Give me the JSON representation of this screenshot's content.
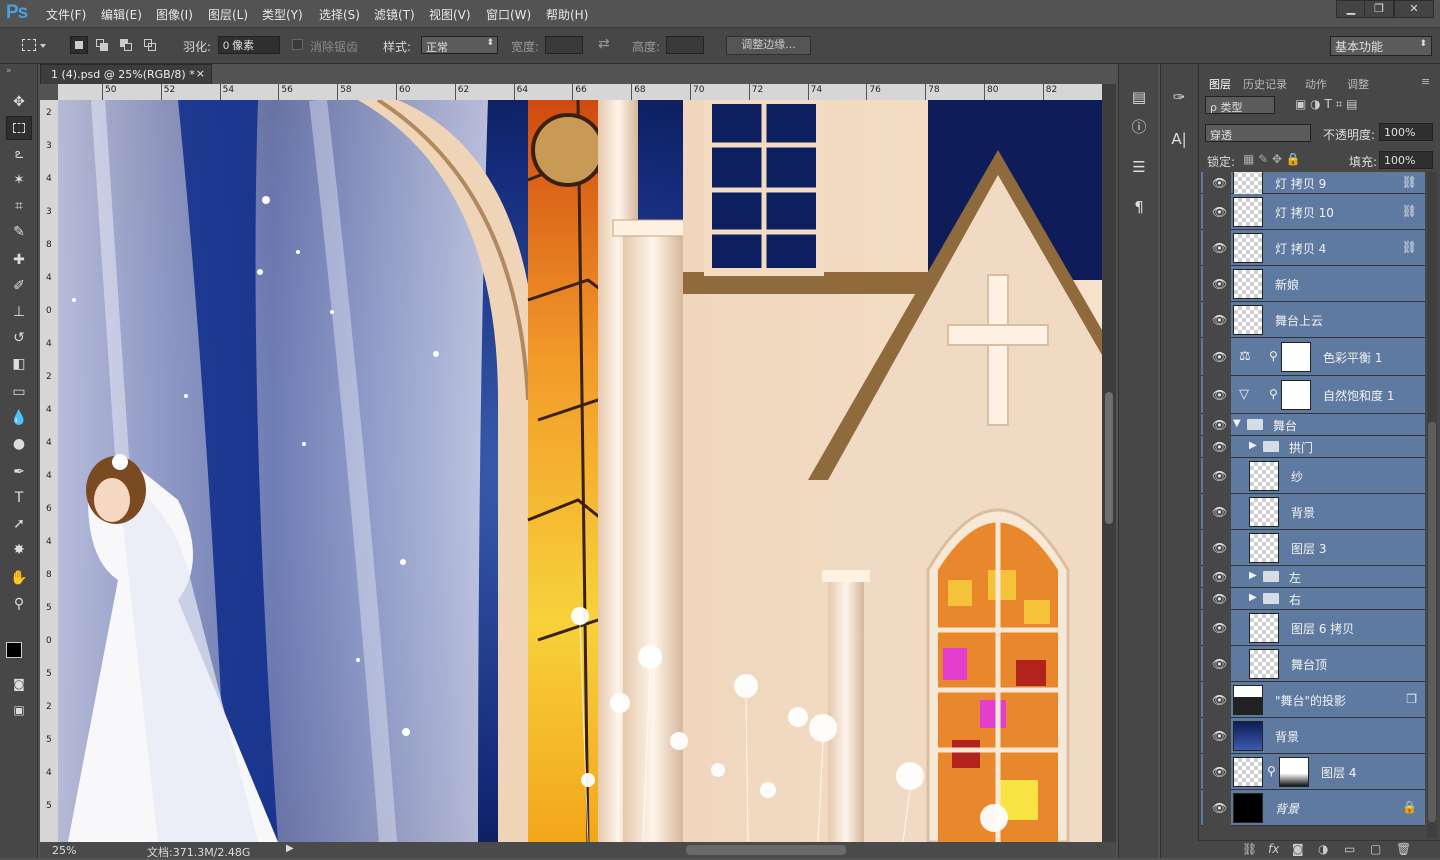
{
  "app": {
    "logo": "Ps"
  },
  "menu": [
    "文件(F)",
    "编辑(E)",
    "图像(I)",
    "图层(L)",
    "类型(Y)",
    "选择(S)",
    "滤镜(T)",
    "视图(V)",
    "窗口(W)",
    "帮助(H)"
  ],
  "window_controls": [
    "▁",
    "❐",
    "✕"
  ],
  "options": {
    "feather_label": "羽化:",
    "feather_value": "0 像素",
    "antialias_label": "消除锯齿",
    "style_label": "样式:",
    "style_value": "正常",
    "width_label": "宽度:",
    "height_label": "高度:",
    "refine_button": "调整边缘...",
    "workspace": "基本功能"
  },
  "document": {
    "tab_title": "1 (4).psd @ 25%(RGB/8) *",
    "close": "×",
    "zoom": "25%",
    "doc_info": "文档:371.3M/2.48G"
  },
  "ruler_h": [
    "50",
    "52",
    "54",
    "56",
    "58",
    "60",
    "62",
    "64",
    "66",
    "68",
    "70",
    "72",
    "74",
    "76",
    "78",
    "80",
    "82"
  ],
  "ruler_v": [
    "2",
    "3",
    "4",
    "3",
    "8",
    "4",
    "0",
    "4",
    "2",
    "4",
    "4",
    "4",
    "6",
    "4",
    "8",
    "5",
    "0",
    "5",
    "2",
    "5",
    "4",
    "5"
  ],
  "panel": {
    "tabs": [
      "图层",
      "历史记录",
      "动作",
      "调整"
    ],
    "filter_kind": "ρ 类型",
    "blend_mode": "穿透",
    "opacity_label": "不透明度:",
    "opacity_value": "100%",
    "lock_label": "锁定:",
    "fill_label": "填充:",
    "fill_value": "100%"
  },
  "layers": [
    {
      "name": "灯 拷贝 9",
      "thumb": "check",
      "link": true
    },
    {
      "name": "灯 拷贝 10",
      "thumb": "check",
      "link": true
    },
    {
      "name": "灯 拷贝 4",
      "thumb": "check",
      "link": true
    },
    {
      "name": "新娘",
      "thumb": "check"
    },
    {
      "name": "舞台上云",
      "thumb": "check"
    },
    {
      "name": "色彩平衡 1",
      "thumb": "white",
      "adj": "⚖"
    },
    {
      "name": "自然饱和度 1",
      "thumb": "white",
      "adj": "▽"
    },
    {
      "name": "舞台",
      "group": true,
      "open": true
    },
    {
      "name": "拱门",
      "group": true,
      "indent": true
    },
    {
      "name": "纱",
      "thumb": "check",
      "indent": true
    },
    {
      "name": "背景",
      "thumb": "check",
      "indent": true
    },
    {
      "name": "图层 3",
      "thumb": "check",
      "indent": true
    },
    {
      "name": "左",
      "group": true,
      "indent": true
    },
    {
      "name": "右",
      "group": true,
      "indent": true
    },
    {
      "name": "图层 6 拷贝",
      "thumb": "check",
      "indent": true
    },
    {
      "name": "舞台顶",
      "thumb": "check",
      "indent": true
    },
    {
      "name": "\"舞台\"的投影",
      "thumb": "dark",
      "badge": true
    },
    {
      "name": "背景",
      "thumb": "night"
    },
    {
      "name": "图层 4",
      "thumb": "check",
      "mask": true
    },
    {
      "name": "背景",
      "thumb": "black",
      "locked": true,
      "italic": true
    }
  ],
  "footer_icons": [
    "link-icon",
    "fx-icon",
    "mask-icon",
    "adjustment-icon",
    "folder-icon",
    "new-layer-icon",
    "trash-icon"
  ]
}
